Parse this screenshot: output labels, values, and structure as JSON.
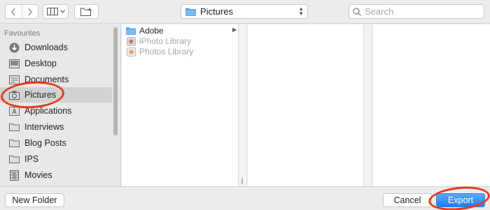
{
  "toolbar": {
    "back_icon": "chevron-left-icon",
    "forward_icon": "chevron-right-icon",
    "view_icon": "column-view-icon",
    "new_folder_icon": "new-folder-icon",
    "path_label": "Pictures",
    "search_placeholder": "Search"
  },
  "sidebar": {
    "heading": "Favourites",
    "items": [
      {
        "label": "Downloads",
        "icon": "download-icon"
      },
      {
        "label": "Desktop",
        "icon": "desktop-icon"
      },
      {
        "label": "Documents",
        "icon": "document-icon"
      },
      {
        "label": "Pictures",
        "icon": "camera-icon",
        "selected": true
      },
      {
        "label": "Applications",
        "icon": "applications-icon"
      },
      {
        "label": "Interviews",
        "icon": "folder-icon"
      },
      {
        "label": "Blog Posts",
        "icon": "folder-icon"
      },
      {
        "label": "IPS",
        "icon": "folder-icon"
      },
      {
        "label": "Movies",
        "icon": "film-icon"
      }
    ]
  },
  "column1": {
    "items": [
      {
        "label": "Adobe",
        "icon": "folder-icon",
        "enabled": true
      },
      {
        "label": "iPhoto Library",
        "icon": "iphoto-icon",
        "enabled": false
      },
      {
        "label": "Photos Library",
        "icon": "photos-icon",
        "enabled": false
      }
    ]
  },
  "buttons": {
    "new_folder": "New Folder",
    "cancel": "Cancel",
    "export": "Export"
  },
  "colors": {
    "accent": "#1f7df6",
    "annotation": "#e63a1a",
    "folder": "#5aa7e8"
  }
}
